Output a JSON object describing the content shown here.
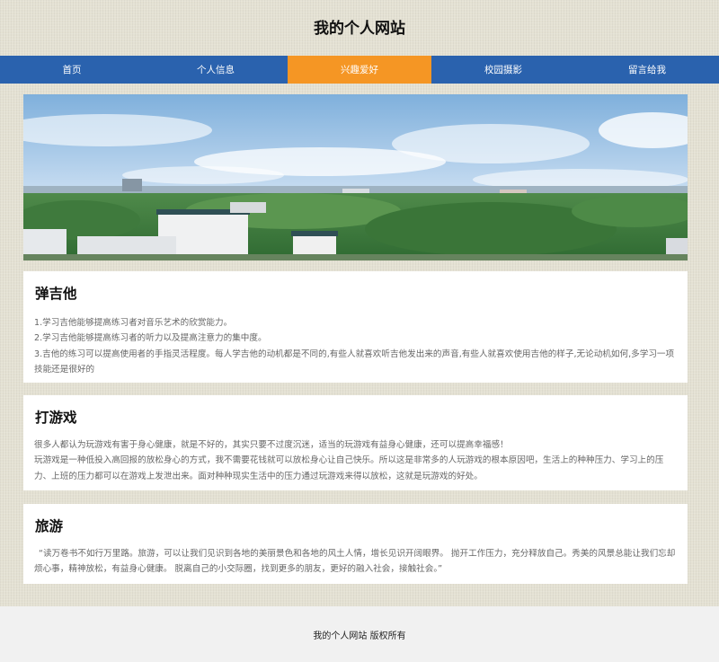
{
  "header": {
    "title": "我的个人网站"
  },
  "nav": {
    "items": [
      {
        "label": "首页"
      },
      {
        "label": "个人信息"
      },
      {
        "label": "兴趣爱好"
      },
      {
        "label": "校园摄影"
      },
      {
        "label": "留言给我"
      }
    ],
    "active_index": 2
  },
  "banner": {
    "image": "campus-panorama"
  },
  "sections": [
    {
      "title": "弹吉他",
      "lines": [
        "1.学习吉他能够提高练习者对音乐艺术的欣赏能力。",
        "2.学习吉他能够提高练习者的听力以及提高注意力的集中度。",
        "3.吉他的练习可以提高使用者的手指灵活程度。每人学吉他的动机都是不同的,有些人就喜欢听吉他发出来的声音,有些人就喜欢使用吉他的样子,无论动机如何,多学习一项技能还是很好的"
      ]
    },
    {
      "title": "打游戏",
      "lines": [
        "很多人都认为玩游戏有害于身心健康，就是不好的，其实只要不过度沉迷，适当的玩游戏有益身心健康，还可以提高幸福感！",
        "玩游戏是一种低投入高回报的放松身心的方式，我不需要花钱就可以放松身心让自己快乐。所以这是非常多的人玩游戏的根本原因吧，生活上的种种压力、学习上的压力、上班的压力都可以在游戏上发泄出来。面对种种现实生活中的压力通过玩游戏来得以放松，这就是玩游戏的好处。"
      ]
    },
    {
      "title": "旅游",
      "lines": [
        "“读万卷书不如行万里路。旅游，可以让我们见识到各地的美丽景色和各地的风土人情，增长见识开阔眼界。 抛开工作压力，充分释放自己。秀美的风景总能让我们忘却烦心事，精神放松，有益身心健康。 脱离自己的小交际圈，找到更多的朋友，更好的融入社会，接触社会。”"
      ]
    }
  ],
  "footer": {
    "text": "我的个人网站 版权所有"
  },
  "colors": {
    "nav": "#2a62ae",
    "nav_active": "#f59624",
    "page_bg": "#e4e1d3"
  }
}
